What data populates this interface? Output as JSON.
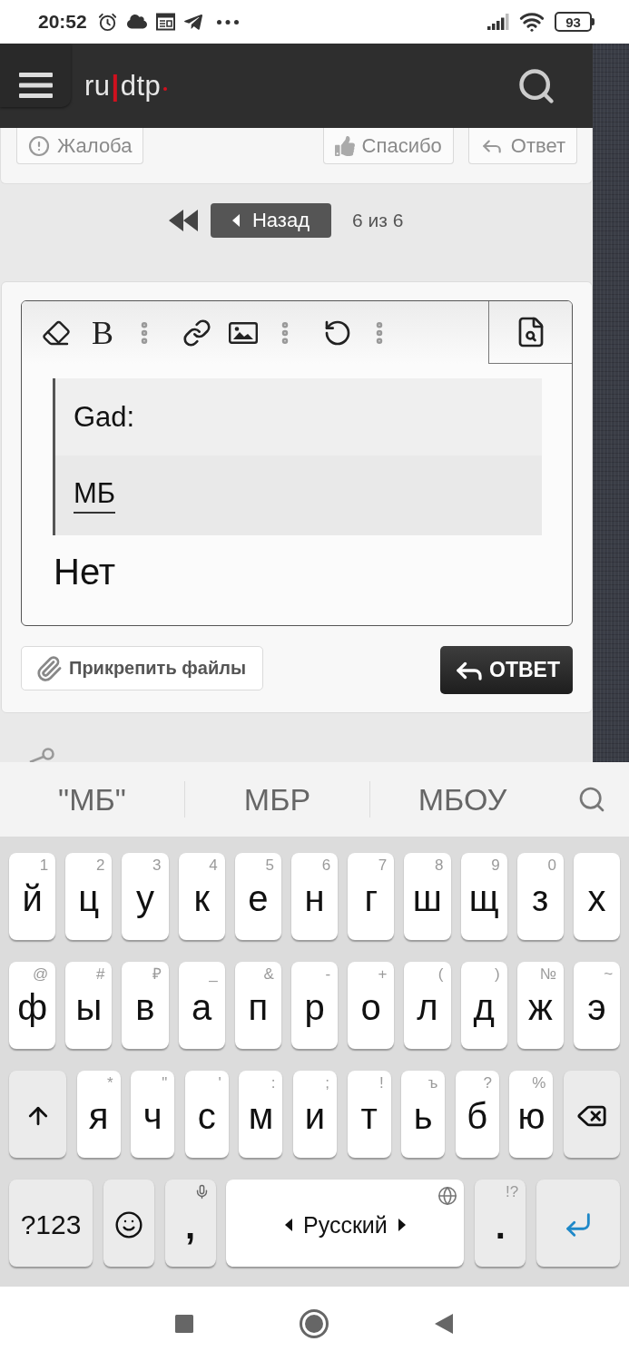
{
  "status_bar": {
    "time": "20:52",
    "battery": "93"
  },
  "header": {
    "logo": {
      "prefix": "ru",
      "separator": "|",
      "suffix": "dtp"
    }
  },
  "post_actions": [
    {
      "kind": "report",
      "label": "Жалоба"
    },
    {
      "kind": "thanks",
      "label": "Спасибо"
    },
    {
      "kind": "reply",
      "label": "Ответ"
    }
  ],
  "pagination": {
    "back_label": "Назад",
    "page_info": "6 из 6"
  },
  "editor": {
    "toolbar": [
      {
        "kind": "eraser"
      },
      {
        "kind": "bold",
        "label": "B"
      },
      {
        "kind": "more"
      },
      {
        "kind": "link"
      },
      {
        "kind": "image"
      },
      {
        "kind": "more"
      },
      {
        "kind": "undo"
      },
      {
        "kind": "more"
      },
      {
        "kind": "preview"
      }
    ],
    "quote": {
      "author": "Gad:",
      "text": "МБ",
      "composing": true
    },
    "text": "Нет"
  },
  "attach_label": "Прикрепить файлы",
  "submit_label": "ОТВЕТ",
  "keyboard": {
    "suggestions": [
      "\"МБ\"",
      "МБР",
      "МБОУ"
    ],
    "top_keys": [
      {
        "kind": "letter",
        "label": "й",
        "hint": "1"
      },
      {
        "kind": "letter",
        "label": "ц",
        "hint": "2"
      },
      {
        "kind": "letter",
        "label": "у",
        "hint": "3"
      },
      {
        "kind": "letter",
        "label": "к",
        "hint": "4"
      },
      {
        "kind": "letter",
        "label": "е",
        "hint": "5"
      },
      {
        "kind": "letter",
        "label": "н",
        "hint": "6"
      },
      {
        "kind": "letter",
        "label": "г",
        "hint": "7"
      },
      {
        "kind": "letter",
        "label": "ш",
        "hint": "8"
      },
      {
        "kind": "letter",
        "label": "щ",
        "hint": "9"
      },
      {
        "kind": "letter",
        "label": "з",
        "hint": "0"
      },
      {
        "kind": "letter",
        "label": "х"
      }
    ],
    "middle_keys": [
      {
        "kind": "letter",
        "label": "ф",
        "hint": "@"
      },
      {
        "kind": "letter",
        "label": "ы",
        "hint": "#"
      },
      {
        "kind": "letter",
        "label": "в",
        "hint": "₽"
      },
      {
        "kind": "letter",
        "label": "а",
        "hint": "_"
      },
      {
        "kind": "letter",
        "label": "п",
        "hint": "&"
      },
      {
        "kind": "letter",
        "label": "р",
        "hint": "-"
      },
      {
        "kind": "letter",
        "label": "о",
        "hint": "+"
      },
      {
        "kind": "letter",
        "label": "л",
        "hint": "("
      },
      {
        "kind": "letter",
        "label": "д",
        "hint": ")"
      },
      {
        "kind": "letter",
        "label": "ж",
        "hint": "№"
      },
      {
        "kind": "letter",
        "label": "э",
        "hint": "~"
      }
    ],
    "lower_keys": [
      {
        "kind": "shift"
      },
      {
        "kind": "letter",
        "label": "я",
        "hint": "*"
      },
      {
        "kind": "letter",
        "label": "ч",
        "hint": "\""
      },
      {
        "kind": "letter",
        "label": "с",
        "hint": "'"
      },
      {
        "kind": "letter",
        "label": "м",
        "hint": ":"
      },
      {
        "kind": "letter",
        "label": "и",
        "hint": ";"
      },
      {
        "kind": "letter",
        "label": "т",
        "hint": "!"
      },
      {
        "kind": "letter",
        "label": "ь",
        "hint": "ъ"
      },
      {
        "kind": "letter",
        "label": "б",
        "hint": "?"
      },
      {
        "kind": "letter",
        "label": "ю",
        "hint": "%"
      },
      {
        "kind": "backspace"
      }
    ],
    "bottom_keys": [
      {
        "kind": "symbols",
        "label": "?123"
      },
      {
        "kind": "emoji"
      },
      {
        "kind": "comma",
        "label": ","
      },
      {
        "kind": "space",
        "label": "Русский"
      },
      {
        "kind": "period",
        "label": ".",
        "hint": "!?"
      },
      {
        "kind": "enter"
      }
    ]
  }
}
